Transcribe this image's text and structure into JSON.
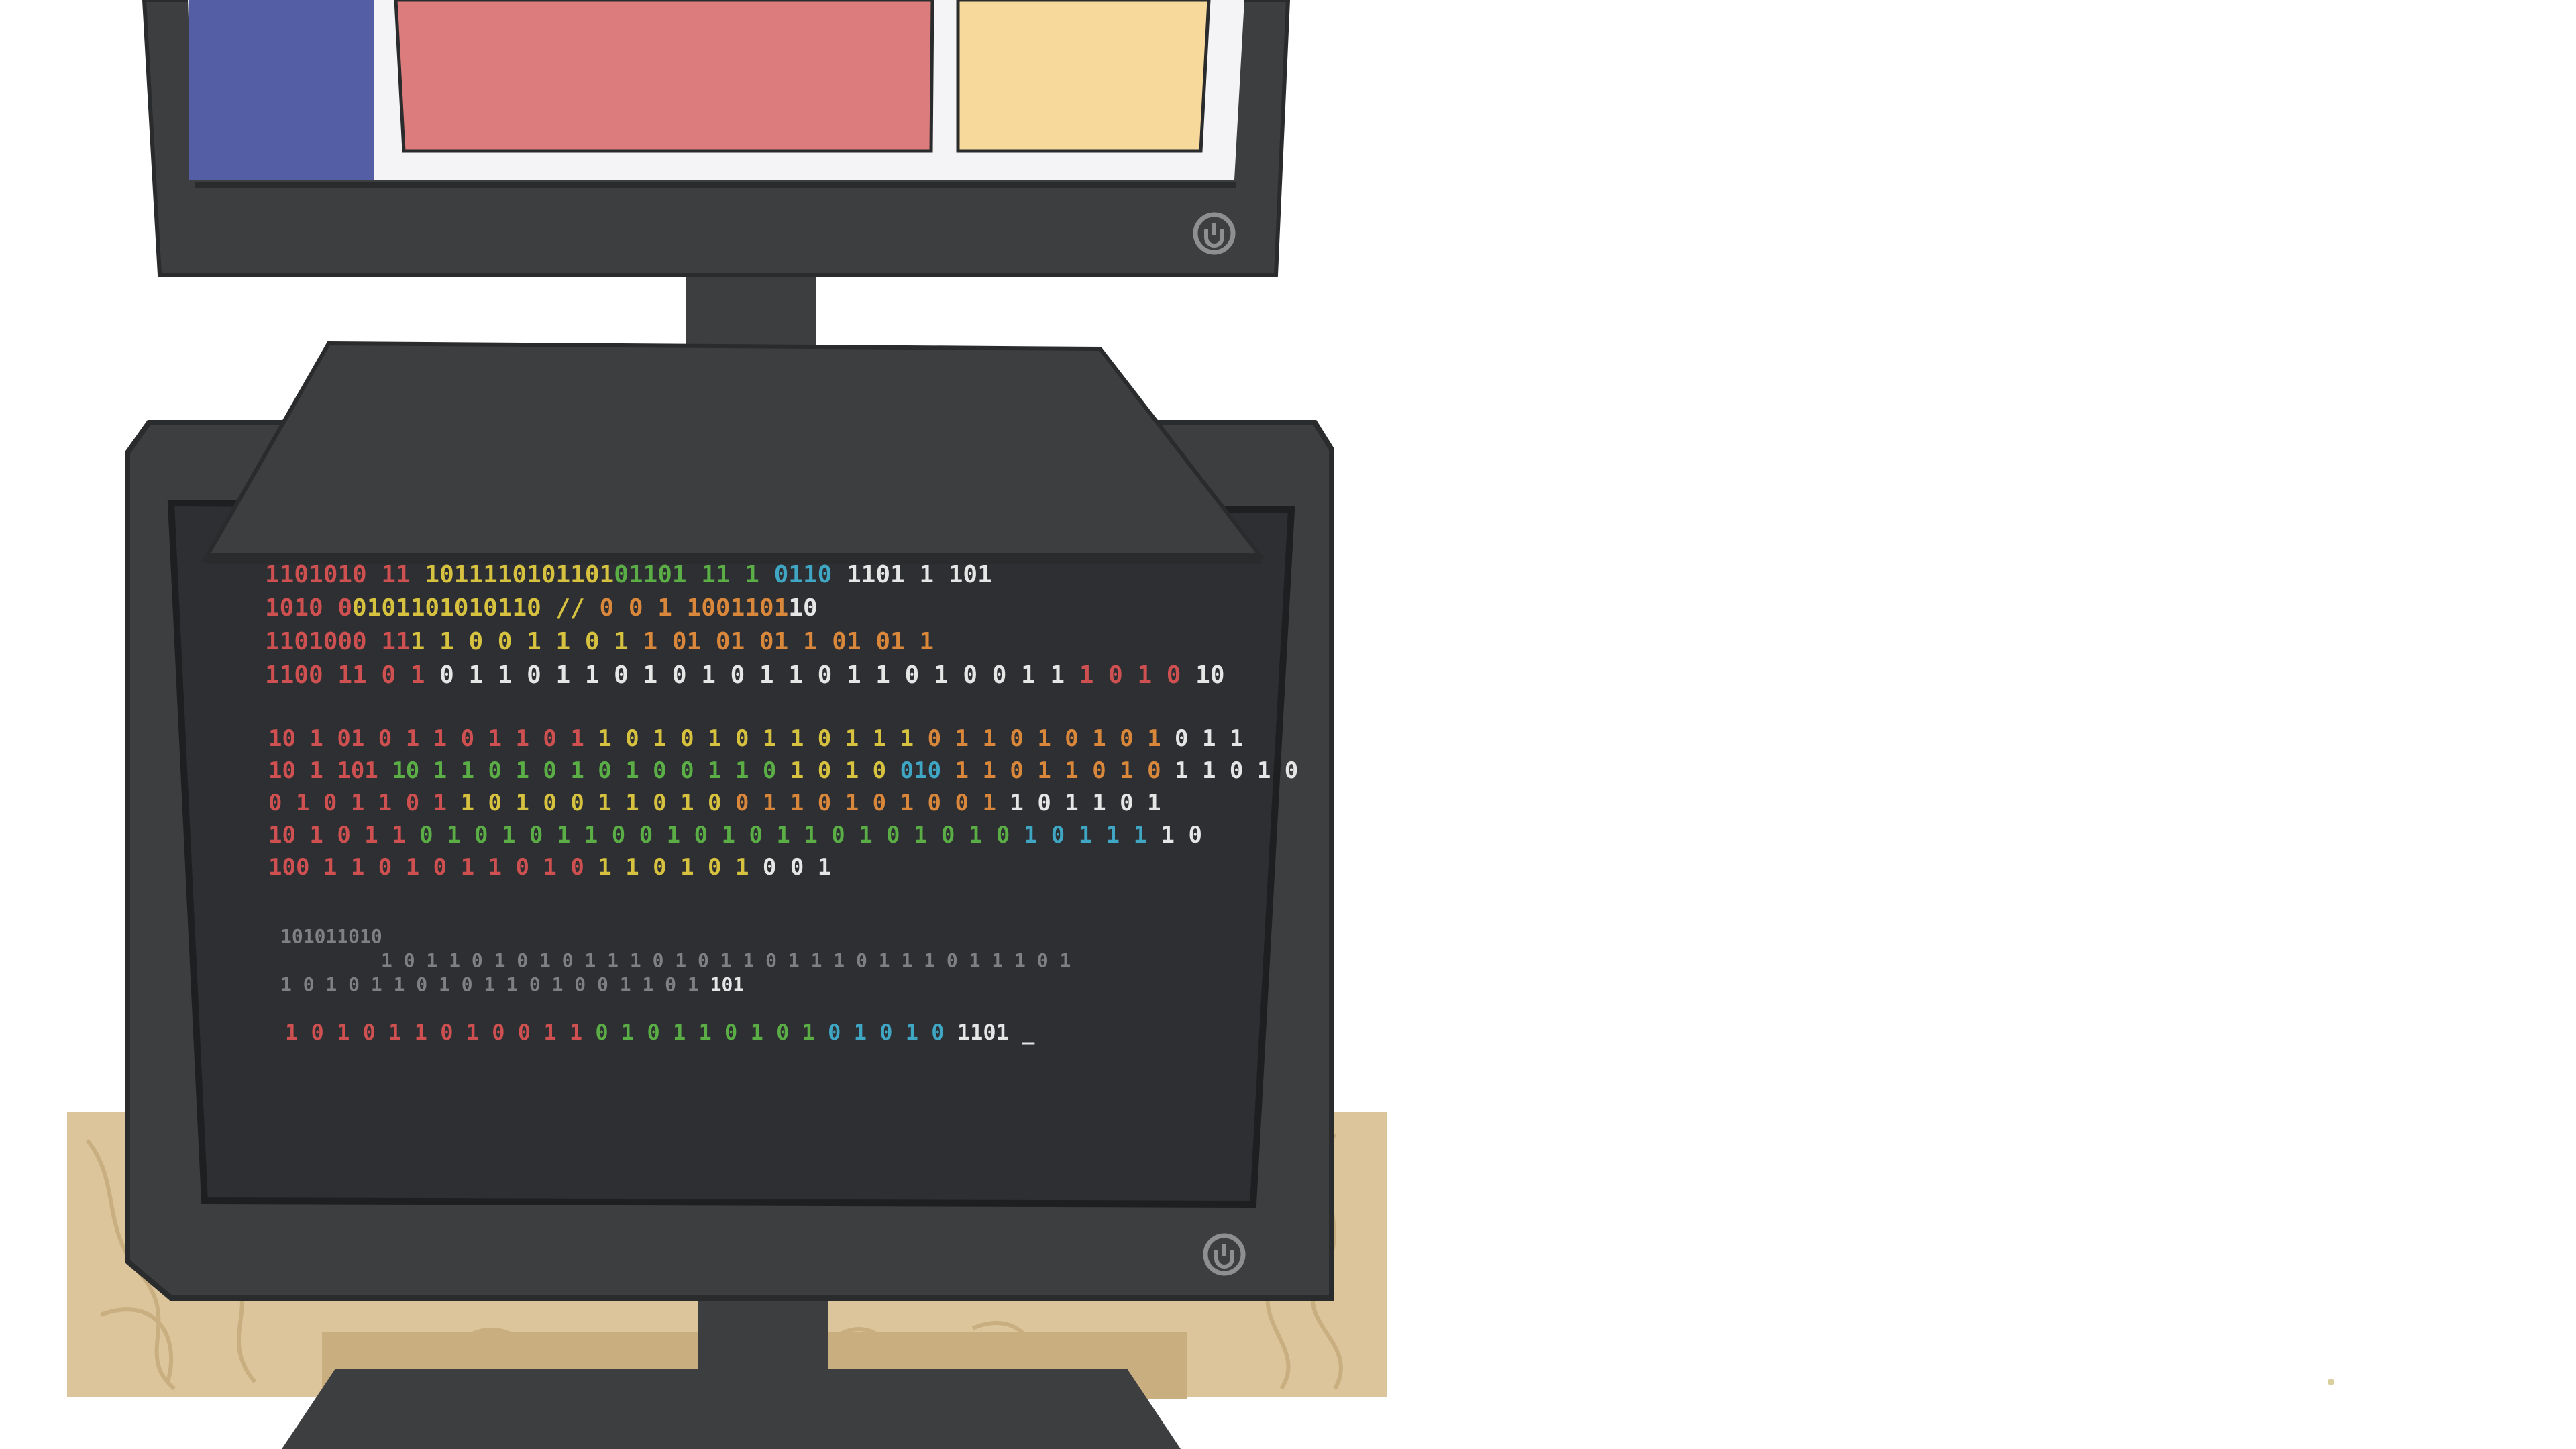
{
  "colors": {
    "background": "#ffffff",
    "desk_wood": "#dcc49b",
    "desk_grain": "#c9ae80",
    "monitor_body": "#3d3e3f",
    "monitor_edge": "#2a2b2c",
    "screen_dark": "#2d2f33",
    "power_ring": "#8e8f91",
    "upper_screen_blue": "#545ea4",
    "upper_screen_red": "#dc7c7c",
    "upper_screen_yellow": "#f8d99c",
    "upper_screen_frame": "#f4f4f6",
    "binary_red": "#cf5050",
    "binary_orange": "#d9873a",
    "binary_yellow": "#d7c240",
    "binary_green": "#5bae46",
    "binary_blue": "#3fa6c4",
    "binary_white": "#e6e6e6",
    "binary_gray": "#7f8084"
  },
  "icons": {
    "upper_power": "power-icon",
    "lower_power": "power-icon"
  },
  "terminal": {
    "groups": [
      [
        [
          [
            "1101010 11",
            "red"
          ],
          [
            " 1011110101101",
            "yellow"
          ],
          [
            "0",
            "green"
          ],
          [
            "1101 11 1",
            "green"
          ],
          [
            " 0110",
            "blue"
          ],
          [
            " 1101 1 101",
            "white"
          ]
        ],
        [
          [
            "1010 0",
            "red"
          ],
          [
            "0101101010110 //",
            "yellow"
          ],
          [
            " 0 0 1 1001101",
            "orange"
          ],
          [
            "10",
            "white"
          ]
        ],
        [
          [
            "1101000 11",
            "red"
          ],
          [
            "1 1 0 0 1 1 0 1 ",
            "yellow"
          ],
          [
            "1 01 01 01 1 01 01 1",
            "orange"
          ]
        ],
        [
          [
            "1100 11 0 1",
            "red"
          ],
          [
            " 0 1 1 0 1 1 0 1 0 1 0 1 1 0 1 1 0 1 0 0 1 1",
            "white"
          ],
          [
            " 1 0 1 0",
            "red"
          ],
          [
            " 10",
            "white"
          ]
        ]
      ],
      [
        [
          [
            "10 1 01 0 1 1 0 1 1 0 1",
            "red"
          ],
          [
            " 1 0 1 0 1 0 1 1 0 1 1 1",
            "yellow"
          ],
          [
            " 0 1 1 0 1 0 1 0 1",
            "orange"
          ],
          [
            " 0 1 1",
            "white"
          ]
        ],
        [
          [
            "10 1  101",
            "red"
          ],
          [
            " 10 1 1 0 1 0 1 0 1 0 0 1 1 0",
            "green"
          ],
          [
            " 1 0 1 0 ",
            "yellow"
          ],
          [
            "010",
            "blue"
          ],
          [
            " 1 1 0 1 1 0 1 0",
            "orange"
          ],
          [
            " 1 1 0 1 0",
            "white"
          ]
        ],
        [
          [
            "0 1 0 1 1 0 1",
            "red"
          ],
          [
            " 1 0 1 0 0 1 1 0 1 0",
            "yellow"
          ],
          [
            " 0 1 1 0 1 0 1 0 0 1",
            "orange"
          ],
          [
            " 1 0 1 1 0 1",
            "white"
          ]
        ],
        [
          [
            "10 1 0 1 1",
            "red"
          ],
          [
            " 0 1 0 1 0 1 1 0 0 1 0 1 0 1 1 0 1 0 1 0 1 0",
            "green"
          ],
          [
            " 1 0 1 1 1",
            "blue"
          ],
          [
            " 1 0",
            "white"
          ]
        ],
        [
          [
            "100 1 1 0 1 0 1 1 0 1 0",
            "red"
          ],
          [
            " 1 1 0 1 0 1",
            "yellow"
          ],
          [
            " 0 0 1",
            "white"
          ]
        ]
      ],
      [
        [
          [
            "101011010",
            "gray"
          ]
        ],
        [
          [
            "1 0 1 1 0 1 0 1 0 1 1 1 0 1 0 1 1 0 1 1 1 0 1 1   1 0 1 1   1 0 1",
            "gray"
          ]
        ],
        [
          [
            "1 0 1 0 1 1 0 1 0 1 1 0 1 0 0 1 1 0 1 ",
            "gray"
          ],
          [
            "101",
            "white"
          ]
        ]
      ],
      [
        [
          [
            "1 0 1 0 1 1 0 1 0 0 1 1",
            "red"
          ],
          [
            " 0 1 0 1 1 0 1 0 1",
            "green"
          ],
          [
            " 0 1 0 1 0",
            "blue"
          ],
          [
            " 1101 _",
            "white"
          ]
        ]
      ]
    ]
  }
}
